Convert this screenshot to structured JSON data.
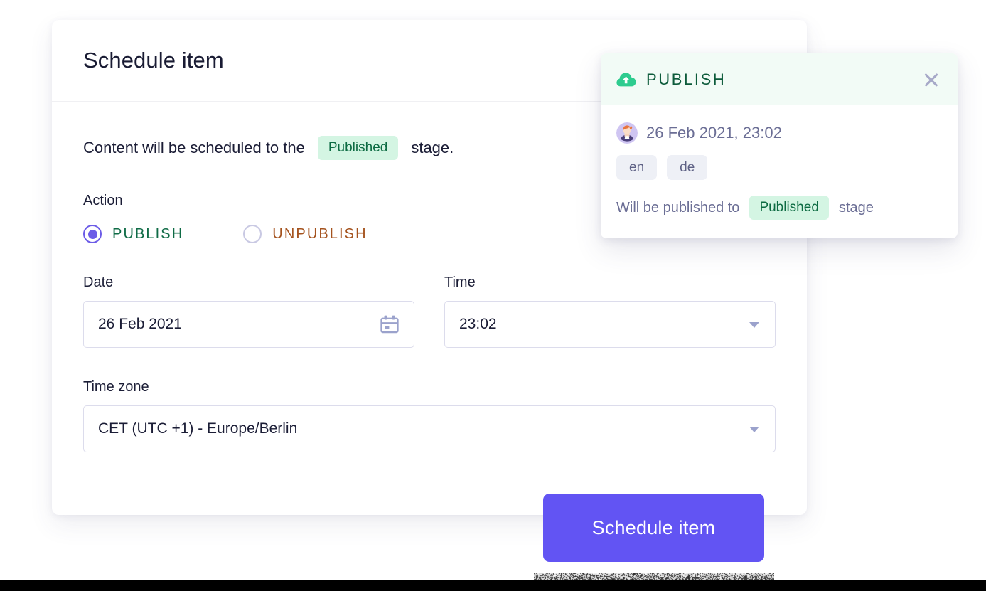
{
  "card": {
    "title": "Schedule item",
    "intro_prefix": "Content will be scheduled to the",
    "intro_stage": "Published",
    "intro_suffix": "stage.",
    "action_label": "Action",
    "radio_publish": "PUBLISH",
    "radio_unpublish": "UNPUBLISH",
    "selected_action": "PUBLISH",
    "date_label": "Date",
    "date_value": "26 Feb 2021",
    "time_label": "Time",
    "time_value": "23:02",
    "timezone_label": "Time zone",
    "timezone_value": "CET (UTC +1) - Europe/Berlin",
    "submit_label": "Schedule item"
  },
  "popup": {
    "title": "PUBLISH",
    "datetime": "26 Feb 2021, 23:02",
    "languages": [
      "en",
      "de"
    ],
    "foot_prefix": "Will be published to",
    "foot_stage": "Published",
    "foot_suffix": "stage"
  },
  "icons": {
    "cloud": "cloud-upload-icon",
    "close": "close-icon",
    "calendar": "calendar-icon",
    "caret": "chevron-down-icon",
    "avatar": "user-avatar"
  },
  "colors": {
    "accent": "#6254f3",
    "stage_chip_bg": "#d4f5e3",
    "stage_chip_text": "#0c6b42",
    "publish_green": "#0f6b46",
    "unpublish_brown": "#a4521d",
    "popup_header_bg": "#f2fbf6",
    "border": "#dcdcec"
  }
}
